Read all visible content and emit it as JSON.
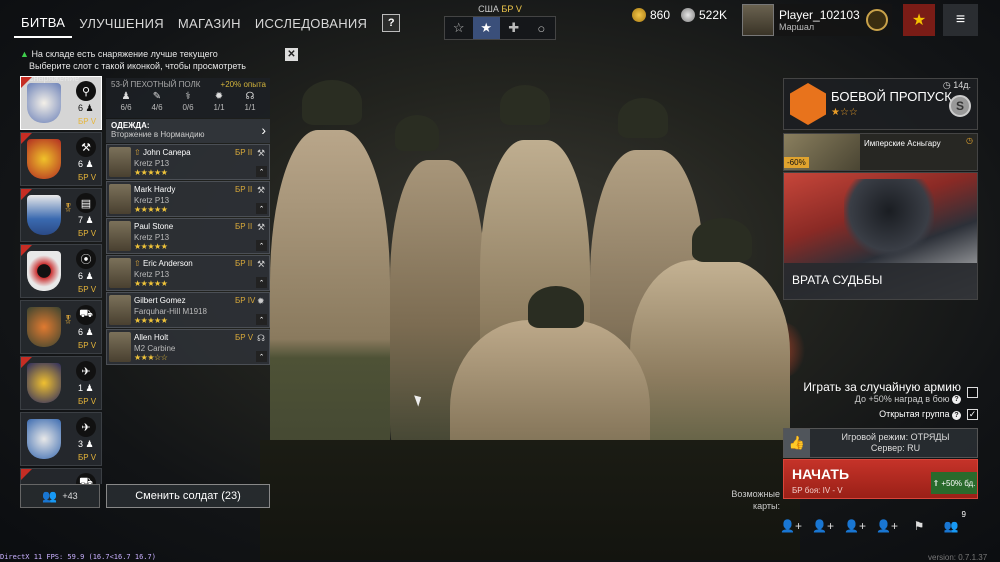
{
  "topnav": {
    "tabs": [
      "БИТВА",
      "УЛУЧШЕНИЯ",
      "МАГАЗИН",
      "ИССЛЕДОВАНИЯ"
    ],
    "help": "?"
  },
  "nation": {
    "name": "США",
    "br": "БР V",
    "tabs": [
      "star-outline-icon",
      "star-icon",
      "cross-icon",
      "circle-icon"
    ]
  },
  "currency": {
    "gold": "860",
    "silver": "522K"
  },
  "player": {
    "name": "Player_102103",
    "rank": "Маршал"
  },
  "notice": {
    "line1": "На складе есть снаряжение лучше текущего",
    "line2": "Выберите слот с такой иконкой, чтобы просмотреть снаряжение"
  },
  "squads": [
    {
      "count": "6",
      "br": "БР V",
      "icon": "⚲",
      "active": true
    },
    {
      "count": "6",
      "br": "БР V",
      "icon": "⚒"
    },
    {
      "count": "7",
      "br": "БР V",
      "icon": "▤"
    },
    {
      "count": "6",
      "br": "БР V",
      "icon": "⦿"
    },
    {
      "count": "6",
      "br": "БР V",
      "icon": "⛟"
    },
    {
      "count": "1",
      "br": "БР V",
      "icon": "✈"
    },
    {
      "count": "3",
      "br": "БР V",
      "icon": "✈"
    },
    {
      "count": "",
      "br": "",
      "icon": "⛟"
    }
  ],
  "reserve": {
    "count": "+43"
  },
  "change_soldier": "Сменить солдат (23)",
  "details": {
    "regiment": "53-Й ПЕХОТНЫЙ ПОЛК",
    "exp": "+20% опыта",
    "stats": [
      {
        "icon": "♟",
        "value": "6/6"
      },
      {
        "icon": "✎",
        "value": "4/6"
      },
      {
        "icon": "⚕",
        "value": "0/6"
      },
      {
        "icon": "✹",
        "value": "1/1"
      },
      {
        "icon": "☊",
        "value": "1/1"
      }
    ],
    "outfit_label": "ОДЕЖДА:",
    "outfit_value": "Вторжение в Нормандию"
  },
  "soldiers": [
    {
      "name": "John Canepa",
      "weapon": "Kretz P13",
      "br": "БР II",
      "stars": "★★★★★",
      "icon": "🔧"
    },
    {
      "name": "Mark Hardy",
      "weapon": "Kretz P13",
      "br": "БР II",
      "stars": "★★★★★",
      "icon": "🔧"
    },
    {
      "name": "Paul Stone",
      "weapon": "Kretz P13",
      "br": "БР II",
      "stars": "★★★★★",
      "icon": "🔧"
    },
    {
      "name": "Eric Anderson",
      "weapon": "Kretz P13",
      "br": "БР II",
      "stars": "★★★★★",
      "icon": "🔧"
    },
    {
      "name": "Gilbert Gomez",
      "weapon": "Farquhar-Hill M1918",
      "br": "БР IV",
      "stars": "★★★★★",
      "icon": "✹"
    },
    {
      "name": "Allen Holt",
      "weapon": "M2 Carbine",
      "br": "БР V",
      "stars": "★★★☆☆",
      "icon": "☊"
    }
  ],
  "battlepass": {
    "title": "БОЕВОЙ ПРОПУСК",
    "stars": "★☆☆",
    "days": "14д.",
    "coin": "S"
  },
  "offer": {
    "title": "Имперские Асньгару",
    "discount": "-60%"
  },
  "event": {
    "title": "ВРАТА СУДЬБЫ"
  },
  "options": {
    "random_army": "Играть за случайную армию",
    "random_army_sub": "До +50% наград в бою",
    "open_group": "Открытая группа"
  },
  "mode": {
    "line1": "Игровой режим: ОТРЯДЫ",
    "line2": "Сервер: RU"
  },
  "start": {
    "label": "НАЧАТЬ",
    "sub": "БР боя: IV - V",
    "boost": "+50% бд."
  },
  "maps_label": "Возможные карты:",
  "bottom": {
    "badge": "9"
  },
  "fps": "DirectX 11 FPS: 59.9 (16.7<16.7 16.7)",
  "version": "version: 0.7.1.37",
  "colors": {
    "accent_red": "#c53329",
    "br_gold": "#e6b53a",
    "star_gold": "#f0c43a",
    "upgrade_green": "#3ecf4c"
  }
}
